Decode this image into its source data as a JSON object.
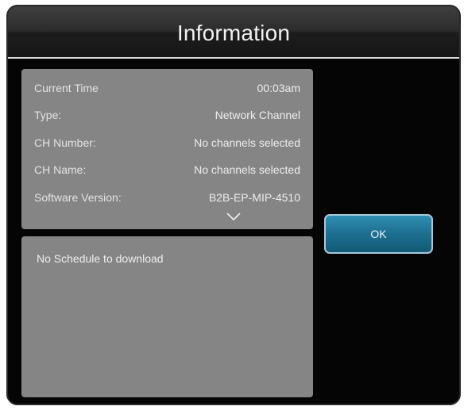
{
  "dialog": {
    "title": "Information"
  },
  "info": {
    "rows": [
      {
        "label": "Current Time",
        "value": "00:03am"
      },
      {
        "label": "Type:",
        "value": "Network Channel"
      },
      {
        "label": "CH Number:",
        "value": "No channels selected"
      },
      {
        "label": "CH Name:",
        "value": "No channels selected"
      },
      {
        "label": "Software Version:",
        "value": "B2B-EP-MIP-4510"
      }
    ],
    "scroll_icon": "chevron-down-icon"
  },
  "schedule": {
    "message": "No Schedule to download"
  },
  "buttons": {
    "ok_label": "OK"
  },
  "colors": {
    "background": "#050505",
    "panel": "#858585",
    "ok_button": "#1d6f8f"
  }
}
